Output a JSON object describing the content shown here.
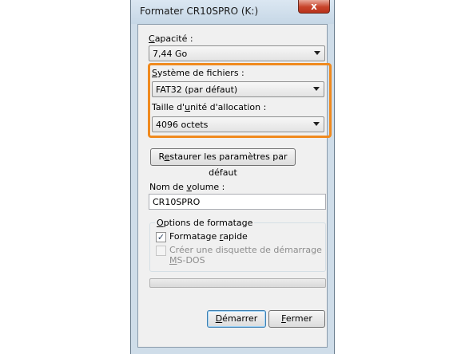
{
  "window": {
    "title": "Formater CR10SPRO (K:)",
    "close_glyph": "x"
  },
  "capacity": {
    "label_prefix": "",
    "label_hot": "C",
    "label_rest": "apacité :",
    "value": "7,44 Go"
  },
  "filesystem": {
    "label_prefix": "",
    "label_hot": "S",
    "label_rest": "ystème de fichiers :",
    "value": "FAT32 (par défaut)"
  },
  "allocation": {
    "label_prefix": "Taille d'",
    "label_hot": "u",
    "label_rest": "nité d'allocation :",
    "value": "4096 octets"
  },
  "restore_button": {
    "label_prefix": "R",
    "label_hot": "e",
    "label_rest": "staurer les paramètres par défaut"
  },
  "volume": {
    "label_prefix": "Nom de ",
    "label_hot": "v",
    "label_rest": "olume :",
    "value": "CR10SPRO"
  },
  "format_options": {
    "title_prefix": "",
    "title_hot": "O",
    "title_rest": "ptions de formatage",
    "quick": {
      "label_prefix": "Formatage ",
      "label_hot": "r",
      "label_rest": "apide",
      "checked": true
    },
    "msdos": {
      "label_line1": "Créer une disquette de démarrage",
      "label_hot": "M",
      "label_line2_rest": "S-DOS",
      "checked": false
    }
  },
  "progress": {
    "value": 0
  },
  "buttons": {
    "start": {
      "hot": "D",
      "rest": "émarrer"
    },
    "close": {
      "hot": "F",
      "rest": "ermer"
    }
  },
  "colors": {
    "highlight": "#f08a1e",
    "accent": "#3c7fb1"
  }
}
